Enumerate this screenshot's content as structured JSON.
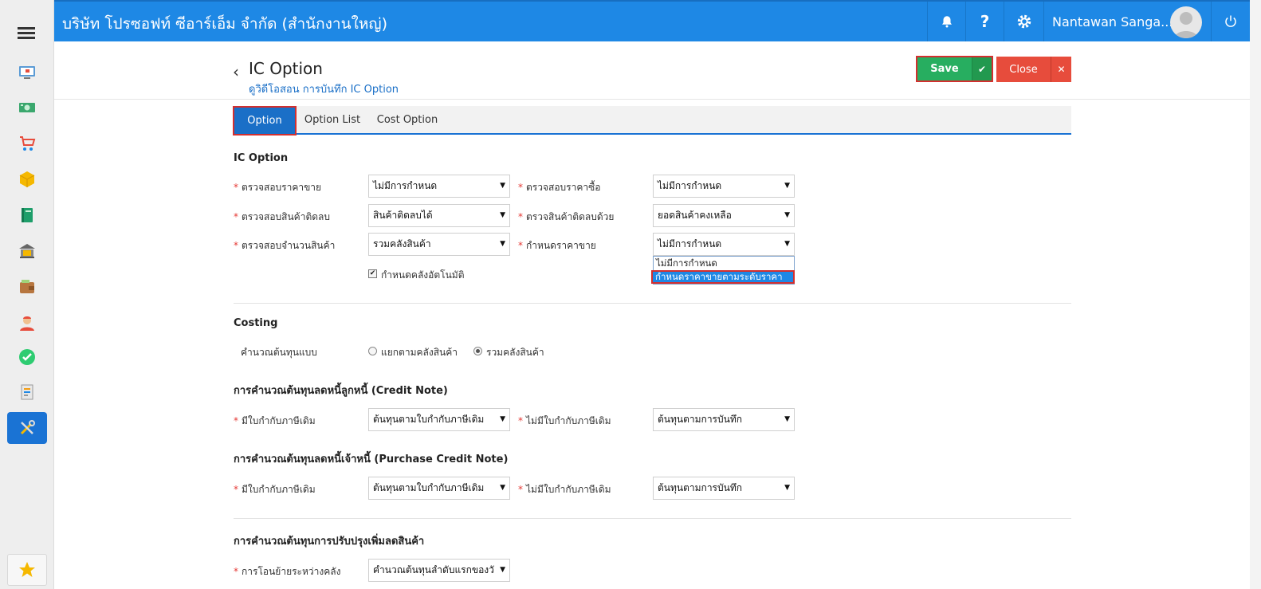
{
  "app": {
    "company_title": "บริษัท โปรซอฟท์ ซีอาร์เอ็ม จำกัด (สำนักงานใหญ่)",
    "user_name": "Nantawan Sanga..."
  },
  "sidebar": {
    "items": [
      {
        "icon": "monitor-icon"
      },
      {
        "icon": "money-icon"
      },
      {
        "icon": "cart-icon"
      },
      {
        "icon": "box-icon"
      },
      {
        "icon": "book-icon"
      },
      {
        "icon": "bank-icon"
      },
      {
        "icon": "wallet-icon"
      },
      {
        "icon": "user-icon"
      },
      {
        "icon": "check-circle-icon"
      },
      {
        "icon": "document-icon"
      },
      {
        "icon": "tools-icon",
        "active": true
      }
    ],
    "favorite_icon": "star-icon"
  },
  "header": {
    "title": "IC Option",
    "breadcrumb": "ดูวิดีโอสอน การบันทึก IC Option",
    "save_label": "Save",
    "close_label": "Close"
  },
  "tabs": [
    {
      "label": "Option",
      "active": true
    },
    {
      "label": "Option List"
    },
    {
      "label": "Cost Option"
    }
  ],
  "ic_option": {
    "title": "IC Option",
    "fields": {
      "check_sale_price": {
        "label": "ตรวจสอบราคาขาย",
        "value": "ไม่มีการกำหนด"
      },
      "check_purchase_price": {
        "label": "ตรวจสอบราคาซื้อ",
        "value": "ไม่มีการกำหนด"
      },
      "check_negative_stock": {
        "label": "ตรวจสอบสินค้าติดลบ",
        "value": "สินค้าติดลบได้"
      },
      "check_negative_with": {
        "label": "ตรวจสินค้าติดลบด้วย",
        "value": "ยอดสินค้าคงเหลือ"
      },
      "check_quantity": {
        "label": "ตรวจสอบจำนวนสินค้า",
        "value": "รวมคลังสินค้า"
      },
      "set_sale_price": {
        "label": "กำหนดราคาขาย",
        "value": "ไม่มีการกำหนด"
      }
    },
    "dropdown_options": [
      "ไม่มีการกำหนด",
      "กำหนดราคาขายตามระดับราคา"
    ],
    "auto_warehouse": {
      "label": "กำหนดคลังอัตโนมัติ",
      "checked": true
    }
  },
  "costing": {
    "title": "Costing",
    "method_label": "คำนวณต้นทุนแบบ",
    "radio_by_warehouse": "แยกตามคลังสินค้า",
    "radio_combined": "รวมคลังสินค้า",
    "selected": "combined"
  },
  "credit_note": {
    "title": "การคำนวณต้นทุนลดหนี้ลูกหนี้ (Credit Note)",
    "with_invoice_label": "มีใบกำกับภาษีเดิม",
    "with_invoice_value": "ต้นทุนตามใบกำกับภาษีเดิม",
    "without_invoice_label": "ไม่มีใบกำกับภาษีเดิม",
    "without_invoice_value": "ต้นทุนตามการบันทึก"
  },
  "purchase_credit_note": {
    "title": "การคำนวณต้นทุนลดหนี้เจ้าหนี้ (Purchase Credit Note)",
    "with_invoice_label": "มีใบกำกับภาษีเดิม",
    "with_invoice_value": "ต้นทุนตามใบกำกับภาษีเดิม",
    "without_invoice_label": "ไม่มีใบกำกับภาษีเดิม",
    "without_invoice_value": "ต้นทุนตามการบันทึก"
  },
  "adjustment": {
    "title": "การคำนวณต้นทุนการปรับปรุงเพิ่มลดสินค้า",
    "transfer_label": "การโอนย้ายระหว่างคลัง",
    "transfer_value": "คำนวณต้นทุนลำดับแรกของวั"
  },
  "colors": {
    "topbar": "#1e88e5",
    "save": "#27ae60",
    "close": "#e74c3c",
    "highlight": "#d32f2f"
  }
}
